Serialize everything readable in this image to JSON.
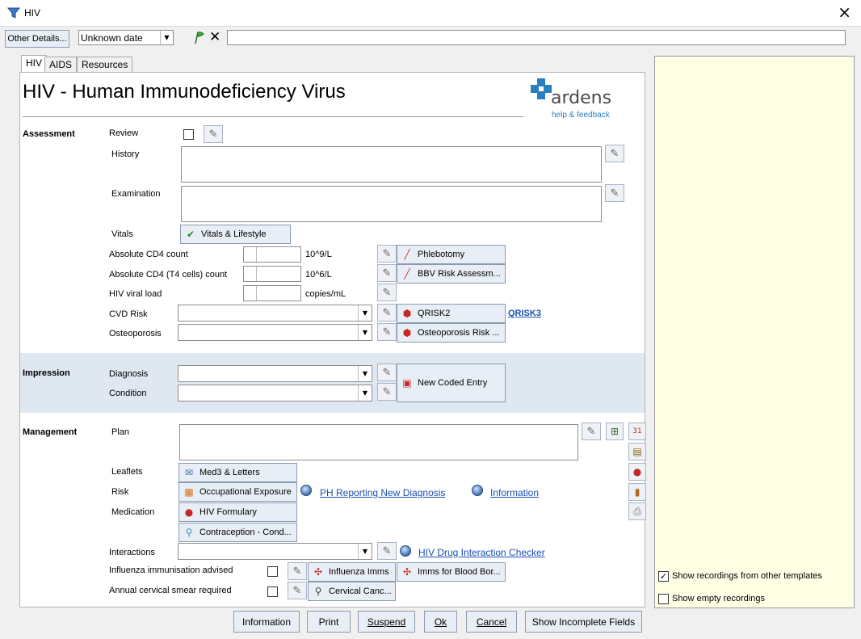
{
  "window": {
    "title": "HIV",
    "close_glyph": "×"
  },
  "toolbar": {
    "other_details_label": "Other Details...",
    "date_value": "Unknown date",
    "flag_icon": "green-flag-icon",
    "clear_icon": "clear-x-icon",
    "comment_value": ""
  },
  "tabs": [
    {
      "label": "HIV",
      "active": true
    },
    {
      "label": "AIDS",
      "active": false
    },
    {
      "label": "Resources",
      "active": false
    }
  ],
  "page": {
    "heading": "HIV - Human Immunodeficiency Virus",
    "logo_text": "ardens",
    "help_link": "help & feedback"
  },
  "assessment": {
    "section_label": "Assessment",
    "review_label": "Review",
    "history_label": "History",
    "examination_label": "Examination",
    "vitals_label": "Vitals",
    "vitals_button": "Vitals & Lifestyle",
    "cd4_label": "Absolute CD4 count",
    "cd4_unit": "10^9/L",
    "cd4_t4_label": "Absolute CD4 (T4 cells) count",
    "cd4_t4_unit": "10^6/L",
    "viral_load_label": "HIV viral load",
    "viral_load_unit": "copies/mL",
    "cvd_label": "CVD Risk",
    "osteo_label": "Osteoporosis",
    "phlebotomy_button": "Phlebotomy",
    "bbv_button": "BBV Risk Assessm...",
    "qrisk2_button": "QRISK2",
    "qrisk3_link": "QRISK3",
    "osteo_button": "Osteoporosis Risk ..."
  },
  "impression": {
    "section_label": "Impression",
    "diagnosis_label": "Diagnosis",
    "condition_label": "Condition",
    "new_coded_button": "New Coded Entry"
  },
  "management": {
    "section_label": "Management",
    "plan_label": "Plan",
    "leaflets_label": "Leaflets",
    "risk_label": "Risk",
    "medication_label": "Medication",
    "med3_button": "Med3 & Letters",
    "occ_button": "Occupational Exposure",
    "hiv_formulary_button": "HIV Formulary",
    "contraception_button": "Contraception - Cond...",
    "ph_reporting_link": "PH Reporting New Diagnosis",
    "information_link": "Information",
    "interactions_label": "Interactions",
    "drug_checker_link": "HIV Drug Interaction Checker",
    "flu_label": "Influenza immunisation advised",
    "flu_button": "Influenza Imms",
    "blood_borne_button": "Imms for Blood Bor...",
    "cervical_label": "Annual cervical smear required",
    "cervical_button": "Cervical Canc..."
  },
  "right_panel": {
    "show_other_label": "Show recordings from other templates",
    "show_other_checked": true,
    "show_empty_label": "Show empty recordings",
    "show_empty_checked": false
  },
  "footer": {
    "information": "Information",
    "print": "Print",
    "suspend": "Suspend",
    "ok": "Ok",
    "cancel": "Cancel",
    "show_incomplete": "Show Incomplete Fields"
  },
  "colors": {
    "accent_blue": "#1a4fb3",
    "impression_band": "#dfe7f1",
    "right_panel_bg": "#ffffe6",
    "logo_blue": "#2a7fc0"
  }
}
